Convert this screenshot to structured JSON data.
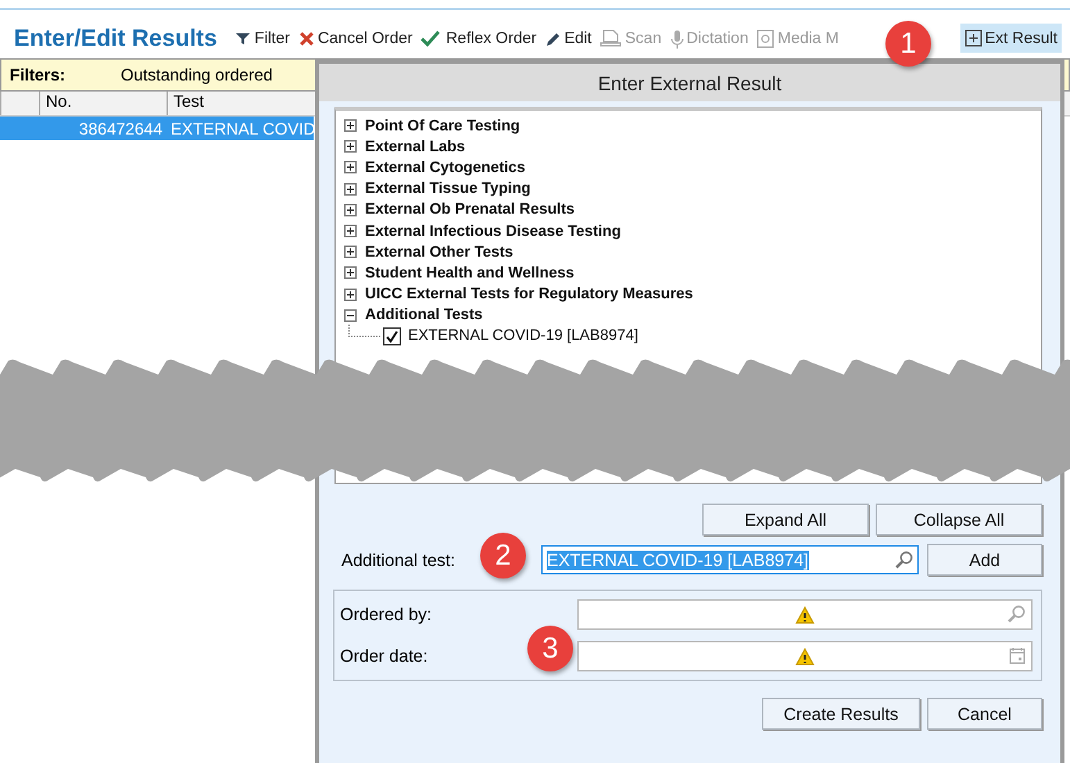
{
  "page": {
    "title": "Enter/Edit Results"
  },
  "toolbar": [
    {
      "kind": "filter",
      "label": "Filter",
      "disabled": false,
      "selected": false
    },
    {
      "kind": "cancel",
      "label": "Cancel Order",
      "disabled": false,
      "selected": false
    },
    {
      "kind": "reflex",
      "label": "Reflex Order",
      "disabled": false,
      "selected": false
    },
    {
      "kind": "edit",
      "label": "Edit",
      "disabled": false,
      "selected": false
    },
    {
      "kind": "scan",
      "label": "Scan",
      "disabled": true,
      "selected": false
    },
    {
      "kind": "dictation",
      "label": "Dictation",
      "disabled": true,
      "selected": false
    },
    {
      "kind": "media",
      "label": "Media M",
      "disabled": true,
      "selected": false
    },
    {
      "kind": "ext",
      "label": "Ext Result",
      "disabled": false,
      "selected": true
    }
  ],
  "filters": {
    "label": "Filters:",
    "value": "Outstanding ordered"
  },
  "table": {
    "columns": [
      "No.",
      "Test"
    ],
    "rows": [
      {
        "cells": [
          "386472644",
          "EXTERNAL COVID"
        ],
        "selected": true
      }
    ]
  },
  "dialog": {
    "title": "Enter External Result",
    "tree": [
      {
        "label": "Point Of Care Testing",
        "expanded": false
      },
      {
        "label": "External Labs",
        "expanded": false
      },
      {
        "label": "External Cytogenetics",
        "expanded": false
      },
      {
        "label": "External Tissue Typing",
        "expanded": false
      },
      {
        "label": "External Ob Prenatal Results",
        "expanded": false
      },
      {
        "label": "External Infectious Disease Testing",
        "expanded": false
      },
      {
        "label": "External Other Tests",
        "expanded": false
      },
      {
        "label": "Student Health and Wellness",
        "expanded": false
      },
      {
        "label": "UICC External Tests for Regulatory Measures",
        "expanded": false
      },
      {
        "label": "Additional Tests",
        "expanded": true,
        "children": [
          {
            "label": "EXTERNAL COVID-19 [LAB8974]",
            "checked": true
          }
        ]
      }
    ],
    "tree_buttons": [
      "Expand All",
      "Collapse All"
    ],
    "additional_test": {
      "label": "Additional test:",
      "value": "EXTERNAL COVID-19 [LAB8974]",
      "button": "Add"
    },
    "fields": [
      {
        "kind": "search",
        "label": "Ordered by:",
        "warning": true
      },
      {
        "kind": "date",
        "label": "Order date:",
        "warning": true
      }
    ],
    "buttons": [
      "Create Results",
      "Cancel"
    ]
  },
  "callouts": [
    "1",
    "2",
    "3"
  ]
}
